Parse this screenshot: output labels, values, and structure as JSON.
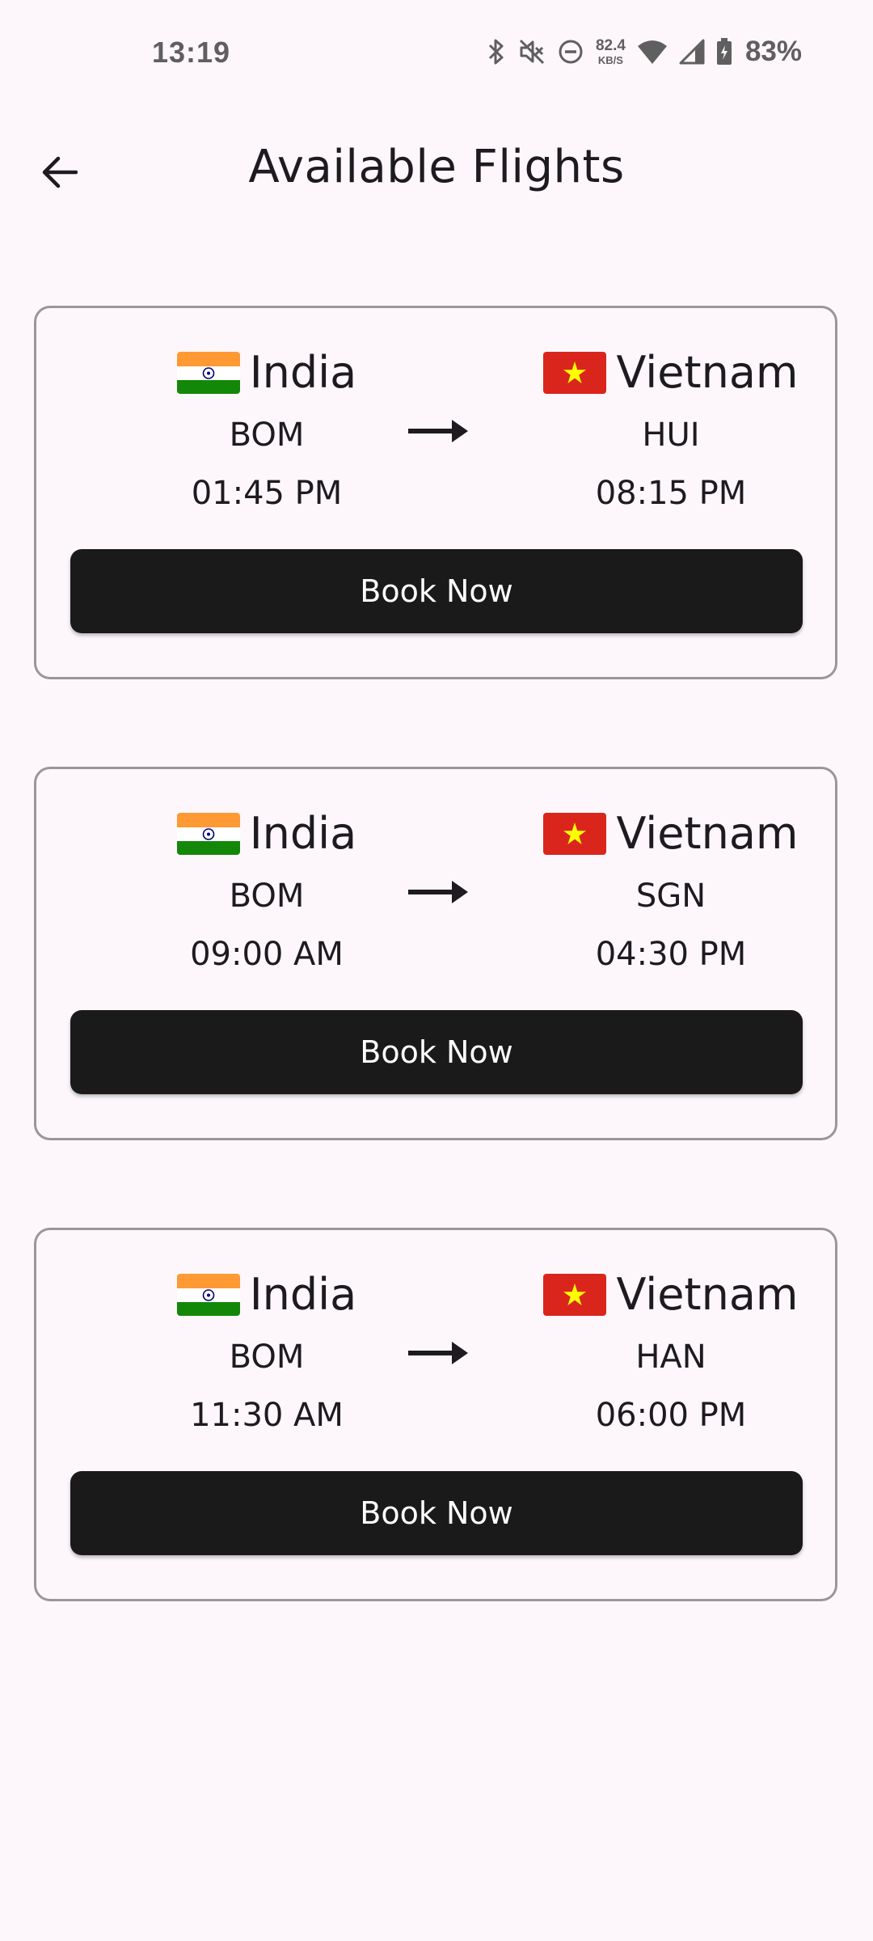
{
  "status_bar": {
    "time": "13:19",
    "net_speed_value": "82.4",
    "net_speed_unit": "KB/S",
    "battery": "83%",
    "icons": [
      "bluetooth-icon",
      "mute-icon",
      "dnd-icon",
      "wifi-icon",
      "signal-icon",
      "battery-icon"
    ]
  },
  "app_bar": {
    "title": "Available Flights",
    "back_icon": "arrow-left-icon"
  },
  "colors": {
    "background": "#fdf7fc",
    "button": "#1a1a1a",
    "card_border": "#9a969b",
    "india_saffron": "#ff9933",
    "india_green": "#138808",
    "india_chakra": "#000080",
    "vietnam_red": "#da251d",
    "vietnam_star": "#ffff00"
  },
  "flights": [
    {
      "origin": {
        "country": "India",
        "code": "BOM",
        "time": "01:45 PM",
        "flag": "india-flag-icon"
      },
      "destination": {
        "country": "Vietnam",
        "code": "HUI",
        "time": "08:15 PM",
        "flag": "vietnam-flag-icon"
      },
      "button_label": "Book Now"
    },
    {
      "origin": {
        "country": "India",
        "code": "BOM",
        "time": "09:00 AM",
        "flag": "india-flag-icon"
      },
      "destination": {
        "country": "Vietnam",
        "code": "SGN",
        "time": "04:30 PM",
        "flag": "vietnam-flag-icon"
      },
      "button_label": "Book Now"
    },
    {
      "origin": {
        "country": "India",
        "code": "BOM",
        "time": "11:30 AM",
        "flag": "india-flag-icon"
      },
      "destination": {
        "country": "Vietnam",
        "code": "HAN",
        "time": "06:00 PM",
        "flag": "vietnam-flag-icon"
      },
      "button_label": "Book Now"
    }
  ]
}
